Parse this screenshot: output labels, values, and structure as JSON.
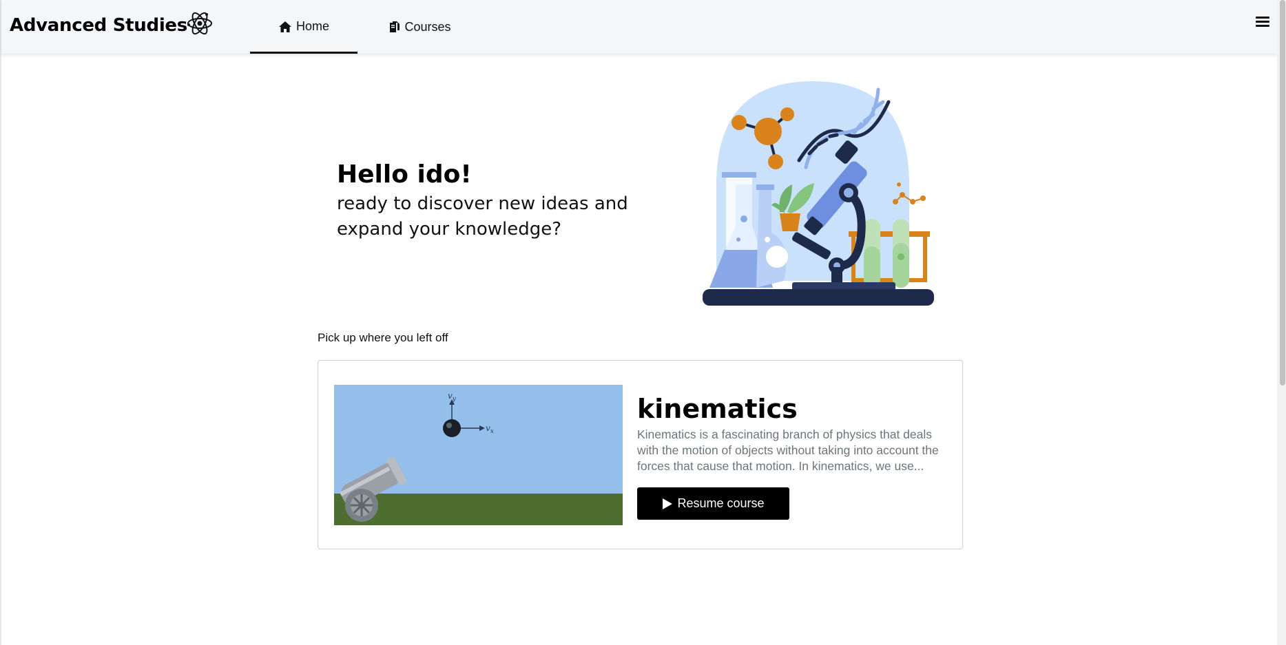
{
  "brand": {
    "name": "Advanced Studies"
  },
  "nav": {
    "home_label": "Home",
    "courses_label": "Courses"
  },
  "hero": {
    "greeting": "Hello ido!",
    "subtitle": "ready to discover new ideas and expand your knowledge?"
  },
  "continue_section": {
    "heading": "Pick up where you left off",
    "course": {
      "title": "kinematics",
      "description": "Kinematics is a fascinating branch of physics that deals with the motion of objects without taking into account the forces that cause that motion. In kinematics, we use...",
      "button_label": "Resume course",
      "thumbnail_labels": {
        "vy": "v",
        "vy_sub": "y",
        "vx": "v",
        "vx_sub": "x"
      }
    }
  },
  "colors": {
    "navbar_bg": "#f5f6f8",
    "sky": "#94bfeb",
    "grass": "#4e6e30",
    "button_bg": "#000000"
  },
  "icons": [
    "atom-icon",
    "home-icon",
    "courses-icon",
    "menu-icon",
    "play-icon"
  ]
}
